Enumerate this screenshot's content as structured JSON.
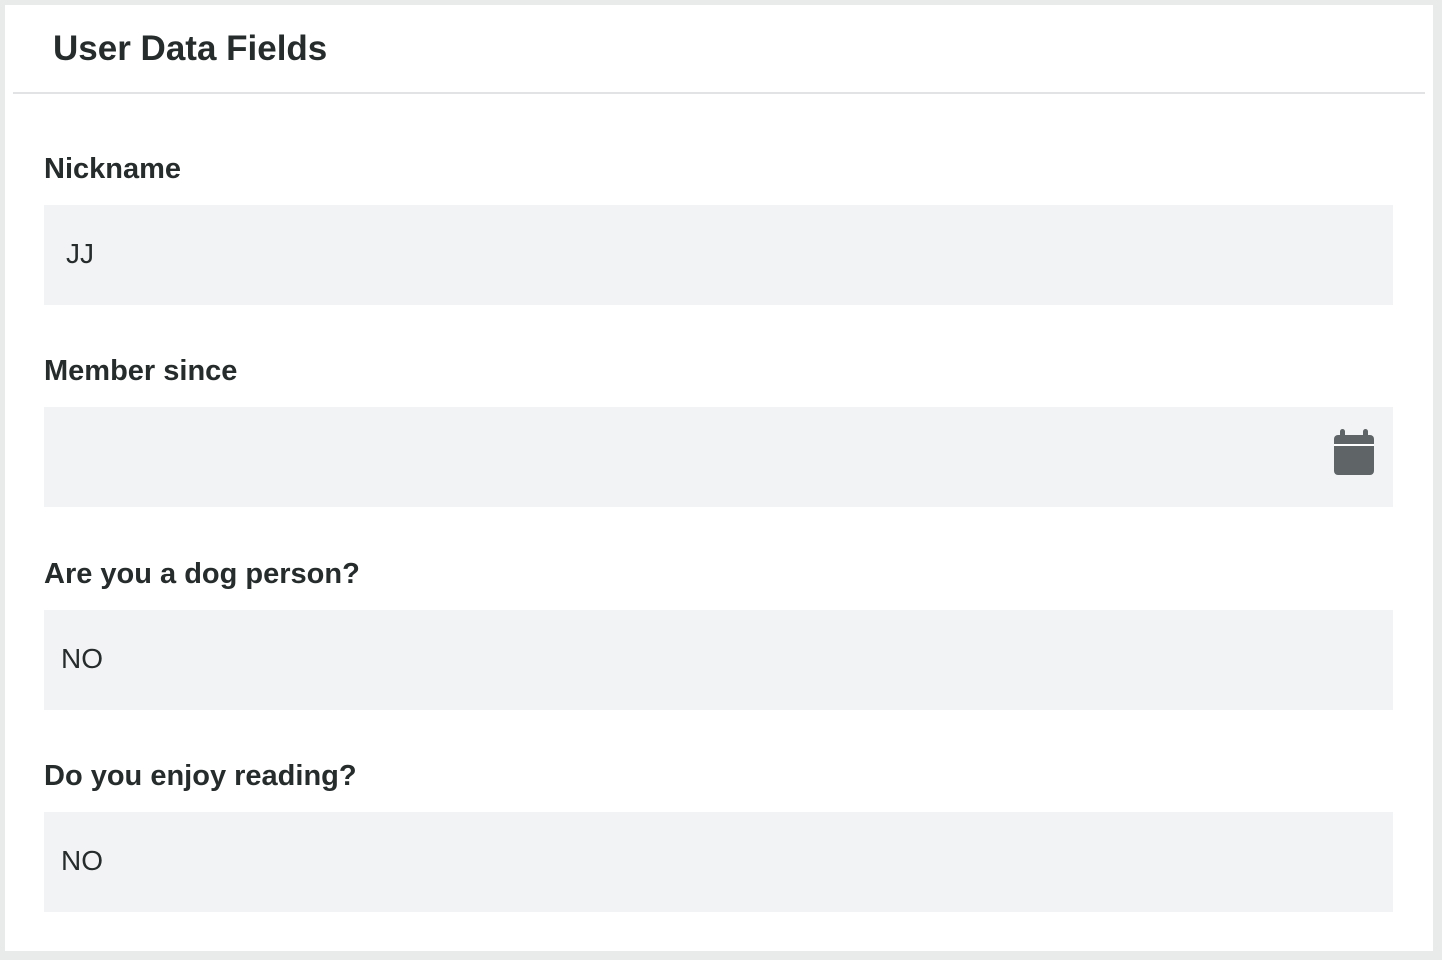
{
  "panel": {
    "title": "User Data Fields"
  },
  "fields": [
    {
      "label": "Nickname",
      "value": "JJ"
    },
    {
      "label": "Member since",
      "value": ""
    },
    {
      "label": "Are you a dog person?",
      "value": "NO"
    },
    {
      "label": "Do you enjoy reading?",
      "value": "NO"
    }
  ],
  "icons": {
    "member_since": "calendar-icon"
  },
  "colors": {
    "panel_background": "#ffffff",
    "page_background": "#e9eaea",
    "field_background": "#f2f3f4",
    "text": "#262b2c",
    "icon": "#5f6466",
    "divider": "#e1e3e4"
  }
}
